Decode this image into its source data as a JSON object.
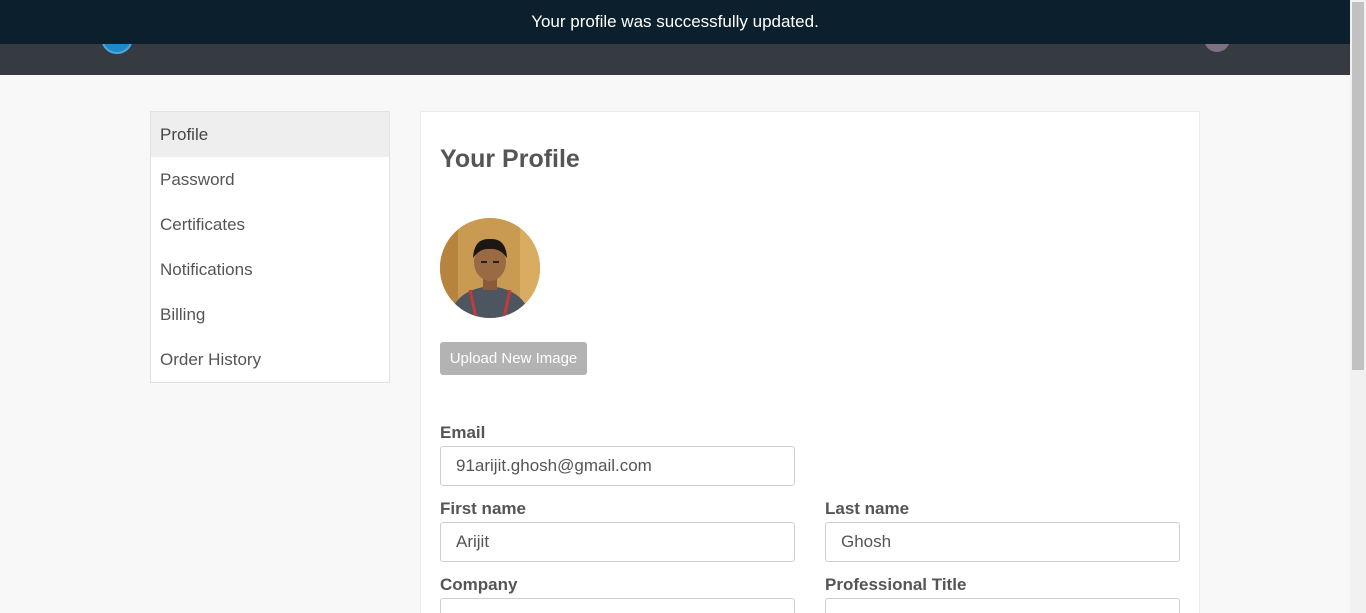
{
  "toast": {
    "message": "Your profile was successfully updated."
  },
  "sidebar": {
    "items": [
      {
        "label": "Profile"
      },
      {
        "label": "Password"
      },
      {
        "label": "Certificates"
      },
      {
        "label": "Notifications"
      },
      {
        "label": "Billing"
      },
      {
        "label": "Order History"
      }
    ]
  },
  "profile": {
    "title": "Your Profile",
    "upload_button": "Upload New Image",
    "email": {
      "label": "Email",
      "value": "91arijit.ghosh@gmail.com"
    },
    "first_name": {
      "label": "First name",
      "value": "Arijit"
    },
    "last_name": {
      "label": "Last name",
      "value": "Ghosh"
    },
    "company": {
      "label": "Company"
    },
    "professional_title": {
      "label": "Professional Title"
    }
  }
}
